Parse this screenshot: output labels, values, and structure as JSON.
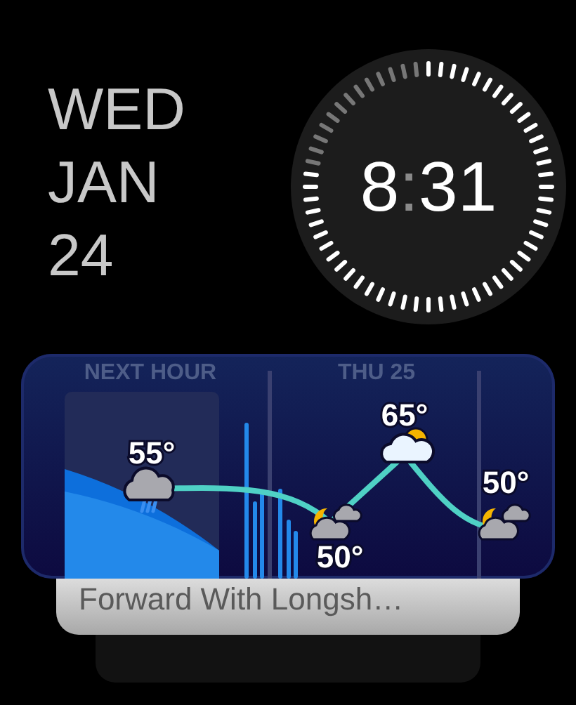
{
  "date": {
    "weekday": "WED",
    "month": "JAN",
    "day": "24"
  },
  "clock": {
    "hours": "8",
    "separator": ":",
    "minutes": "31"
  },
  "stack_card": {
    "title": "Forward With Longsh…"
  },
  "weather": {
    "headers": [
      "NEXT HOUR",
      "THU 25"
    ],
    "points": [
      {
        "temp": "55°",
        "kind": "rain"
      },
      {
        "temp": "50°",
        "kind": "night-cloudy"
      },
      {
        "temp": "65°",
        "kind": "partly-sunny"
      },
      {
        "temp": "50°",
        "kind": "night-cloudy"
      }
    ]
  }
}
